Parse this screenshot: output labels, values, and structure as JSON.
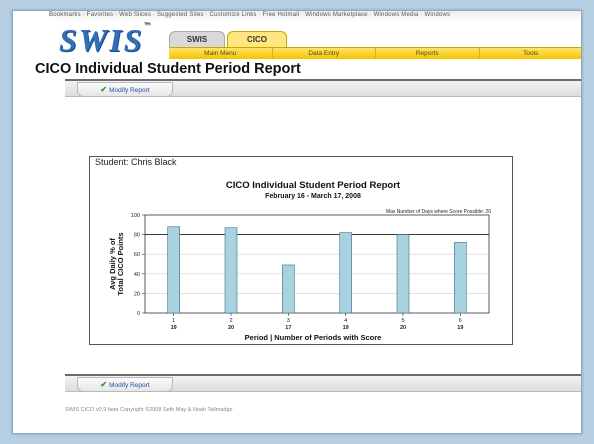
{
  "browser": {
    "toolbar_text": "Bookmarks · Favorites · Web Slices · Suggested Sites · Customize Links · Free Hotmail · Windows Marketplace · Windows Media · Windows"
  },
  "app": {
    "logo": "SWIS",
    "logo_tm": "™"
  },
  "tabs": [
    {
      "label": "SWIS"
    },
    {
      "label": "CICO"
    }
  ],
  "menu": [
    {
      "label": "Main Menu"
    },
    {
      "label": "Data Entry"
    },
    {
      "label": "Reports"
    },
    {
      "label": "Tools"
    }
  ],
  "page": {
    "title": "CICO Individual Student Period Report"
  },
  "toolbar": {
    "modify_label": "Modify Report",
    "modify_icon": "check-icon"
  },
  "report": {
    "student_label": "Student: Chris Black"
  },
  "chart_data": {
    "type": "bar",
    "title": "CICO Individual Student Period Report",
    "subtitle": "February 16 - March 17, 2008",
    "annotation": "Max Number of Days where Score Possible: 20",
    "ylabel_line1": "Avg Daily % of",
    "ylabel_line2": "Total CICO Points",
    "xlabel": "Period | Number of Periods with Score",
    "categories": [
      "1",
      "2",
      "3",
      "4",
      "5",
      "6"
    ],
    "counts": [
      "19",
      "20",
      "17",
      "19",
      "20",
      "19"
    ],
    "values": [
      88,
      87,
      49,
      82,
      80,
      72
    ],
    "ylim": [
      0,
      100
    ],
    "yticks": [
      0,
      20,
      40,
      60,
      80,
      100
    ],
    "reference_line": 80,
    "bar_color": "#a8d2df",
    "bar_edge": "#3d6f80",
    "grid": true
  },
  "footer": {
    "text": "SWIS CICO v0.9 beta Copyright ©2008 Seth May & Noah Tallmadge"
  }
}
